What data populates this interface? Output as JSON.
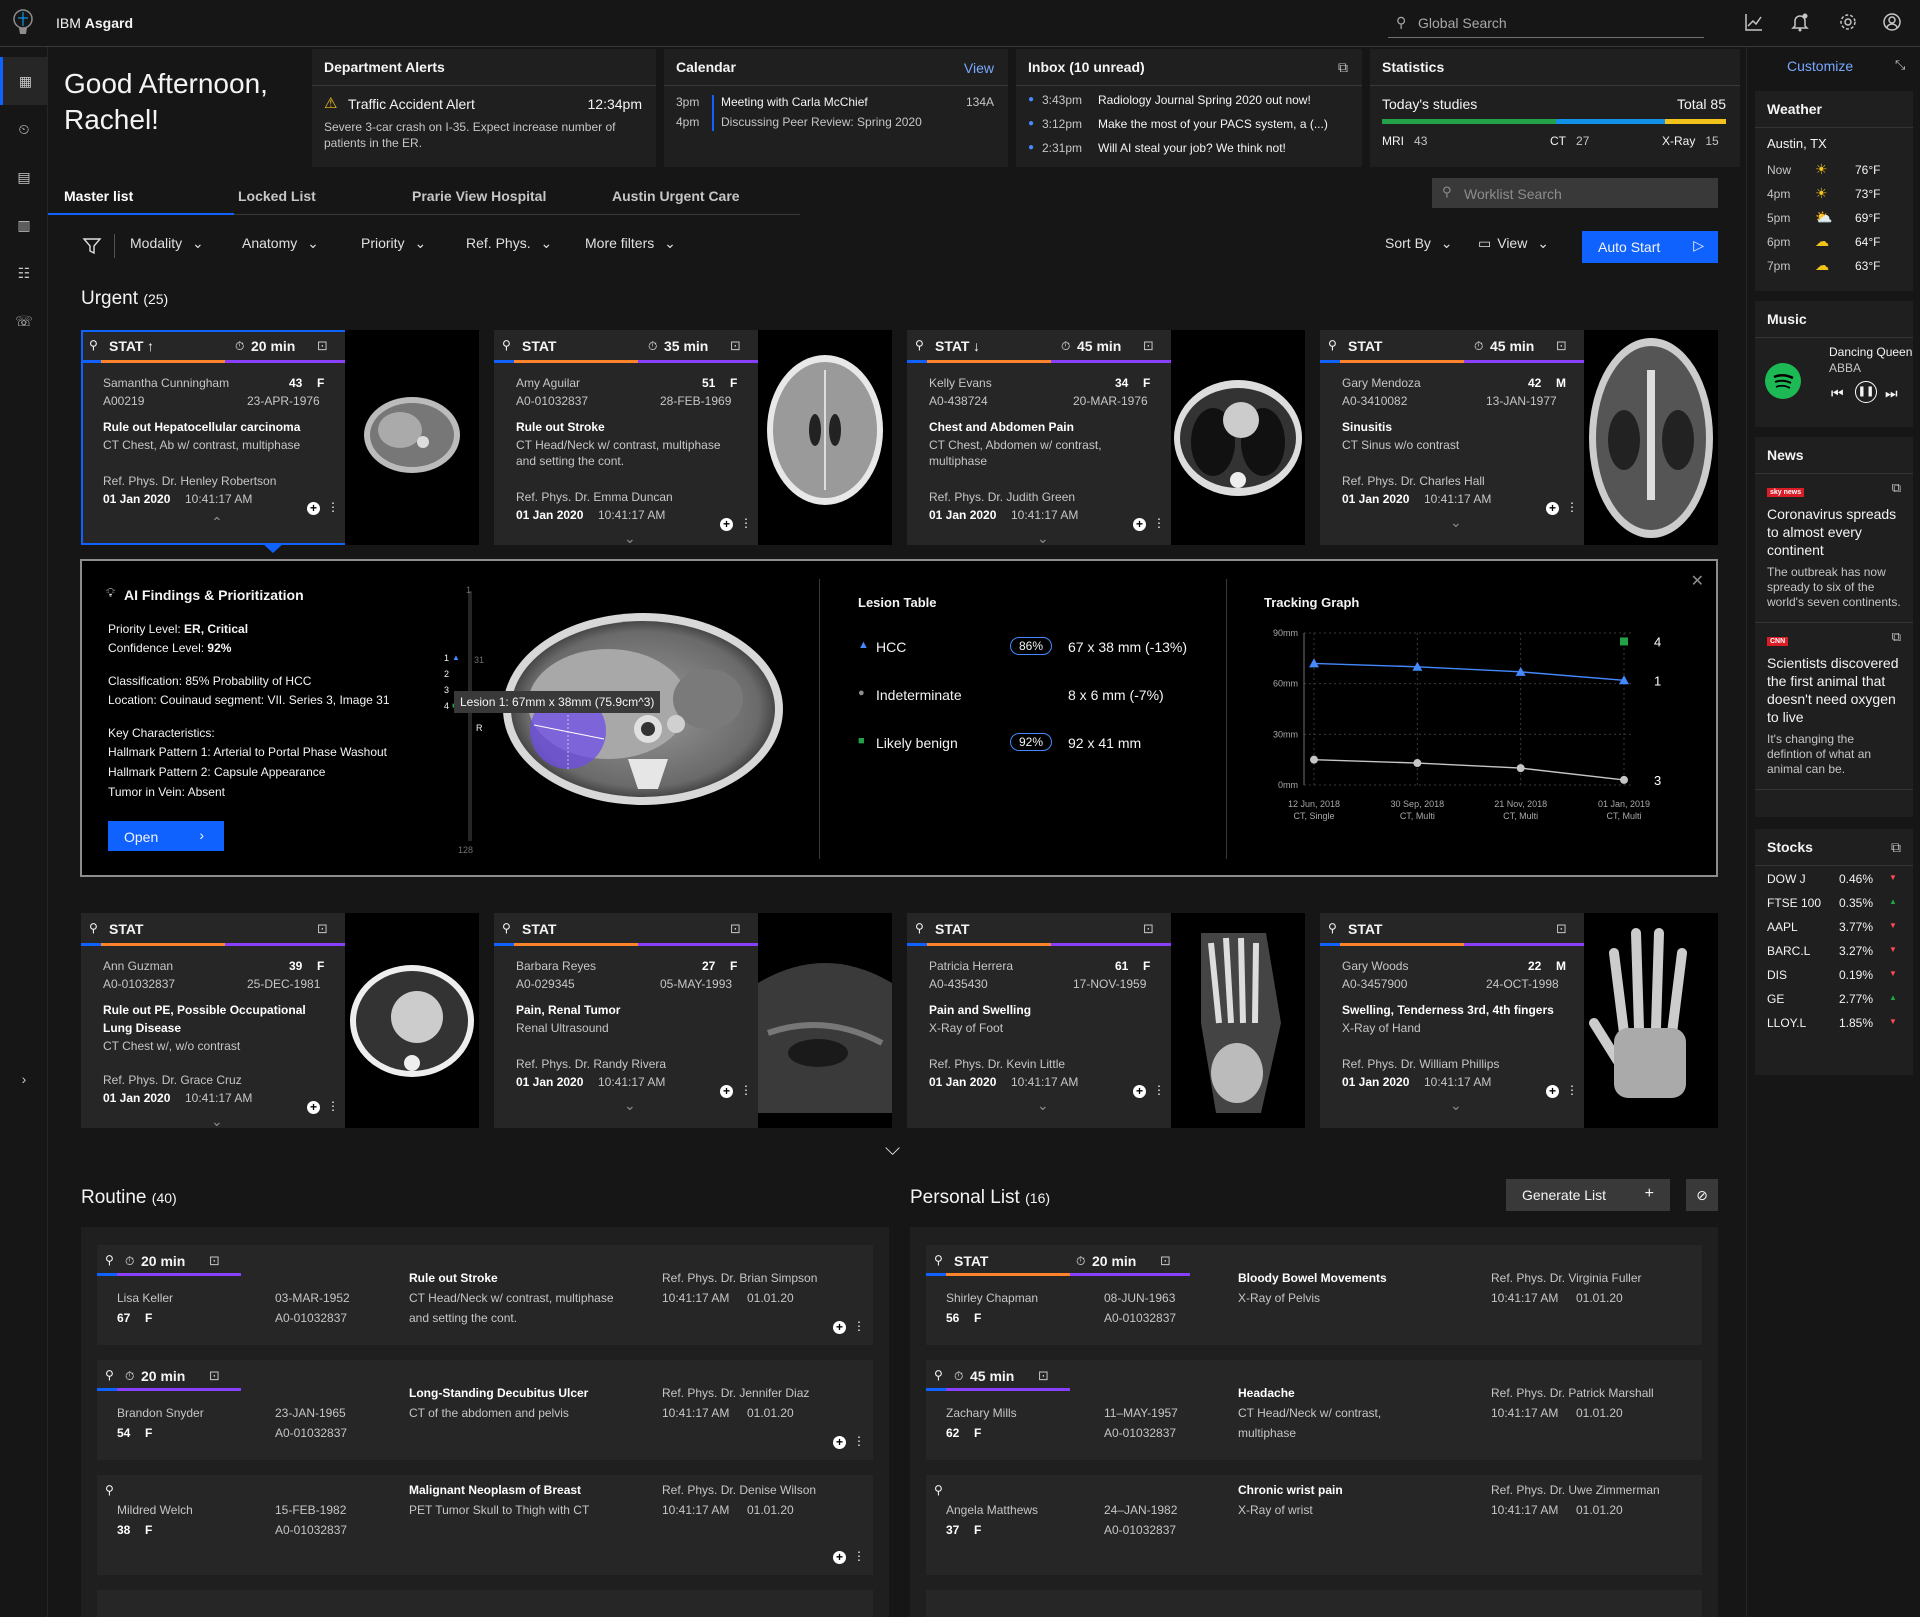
{
  "app": {
    "brand": "IBM",
    "name": "Asgard",
    "search_placeholder": "Global Search"
  },
  "greeting": {
    "line1": "Good Afternoon,",
    "line2": "Rachel!"
  },
  "alerts": {
    "title": "Department Alerts",
    "item_title": "Traffic Accident Alert",
    "time": "12:34pm",
    "body_line1": "Severe 3-car crash on I-35. Expect increase number of",
    "body_line2": "patients in the ER."
  },
  "calendar": {
    "title": "Calendar",
    "view": "View",
    "items": [
      {
        "time": "3pm",
        "text": "Meeting with Carla McChief",
        "room": "134A"
      },
      {
        "time": "4pm",
        "text": "Discussing Peer Review: Spring 2020",
        "room": ""
      }
    ]
  },
  "inbox": {
    "title": "Inbox (10 unread)",
    "items": [
      {
        "time": "3:43pm",
        "text": "Radiology Journal Spring 2020 out now!"
      },
      {
        "time": "3:12pm",
        "text": "Make the most of your PACS system, a (...)"
      },
      {
        "time": "2:31pm",
        "text": "Will AI steal your job? We think not!"
      }
    ]
  },
  "statistics": {
    "title": "Statistics",
    "label": "Today's studies",
    "total": "Total 85",
    "mri_label": "MRI",
    "mri": "43",
    "ct_label": "CT",
    "ct": "27",
    "xray_label": "X-Ray",
    "xray": "15",
    "bar_colors": [
      "#24a148",
      "#1192e8",
      "#f1c21b"
    ]
  },
  "tabs": [
    "Master list",
    "Locked List",
    "Prarie View Hospital",
    "Austin Urgent Care"
  ],
  "worklist_search": "Worklist Search",
  "filters": [
    "Modality",
    "Anatomy",
    "Priority",
    "Ref. Phys.",
    "More filters"
  ],
  "sort_by": "Sort By",
  "view": "View",
  "auto_start": "Auto Start",
  "urgent": {
    "title": "Urgent",
    "count": "(25)"
  },
  "urgent_cards": [
    {
      "stat": "STAT",
      "arrow": "↑",
      "timer": "20 min",
      "name": "Samantha Cunningham",
      "age": "43",
      "sex": "F",
      "id": "A00219",
      "dob": "23-APR-1976",
      "reason": "Rule out Hepatocellular carcinoma",
      "study1": "CT Chest, Ab w/ contrast, multiphase",
      "study2": "",
      "ref": "Ref. Phys. Dr. Henley Robertson",
      "date": "01 Jan 2020",
      "time": "10:41:17 AM"
    },
    {
      "stat": "STAT",
      "arrow": "",
      "timer": "35 min",
      "name": "Amy Aguilar",
      "age": "51",
      "sex": "F",
      "id": "A0-01032837",
      "dob": "28-FEB-1969",
      "reason": "Rule out Stroke",
      "study1": "CT Head/Neck w/ contrast, multiphase",
      "study2": "and setting the cont.",
      "ref": "Ref. Phys. Dr. Emma Duncan",
      "date": "01 Jan 2020",
      "time": "10:41:17 AM"
    },
    {
      "stat": "STAT",
      "arrow": "↓",
      "timer": "45 min",
      "name": "Kelly Evans",
      "age": "34",
      "sex": "F",
      "id": "A0-438724",
      "dob": "20-MAR-1976",
      "reason": "Chest and Abdomen Pain",
      "study1": "CT Chest, Abdomen w/ contrast,",
      "study2": "multiphase",
      "ref": "Ref. Phys. Dr. Judith Green",
      "date": "01 Jan 2020",
      "time": "10:41:17 AM"
    },
    {
      "stat": "STAT",
      "arrow": "",
      "timer": "45 min",
      "name": "Gary Mendoza",
      "age": "42",
      "sex": "M",
      "id": "A0-3410082",
      "dob": "13-JAN-1977",
      "reason": "Sinusitis",
      "study1": "CT Sinus w/o contrast",
      "study2": "",
      "ref": "Ref. Phys. Dr. Charles Hall",
      "date": "01 Jan 2020",
      "time": "10:41:17 AM"
    }
  ],
  "ai": {
    "title": "AI Findings & Prioritization",
    "priority_label": "Priority Level:",
    "priority": "ER, Critical",
    "confidence_label": "Confidence Level:",
    "confidence": "92%",
    "classification": "Classification: 85% Probability of HCC",
    "location": "Location: Couinaud segment: VII. Series 3, Image 31",
    "key": "Key Characteristics:",
    "k1": "Hallmark  Pattern 1: Arterial to Portal Phase Washout",
    "k2": "Hallmark Pattern 2: Capsule Appearance",
    "k3": "Tumor in Vein: Absent",
    "open": "Open",
    "lesion_tooltip": "Lesion 1: 67mm x 38mm (75.9cm^3)",
    "scroll_top": "1",
    "scroll_bottom": "128",
    "marker_31": "31",
    "r_label": "R",
    "markers": [
      "1",
      "2",
      "3",
      "4"
    ],
    "lesion_table_title": "Lesion Table",
    "lesions": [
      {
        "shape": "▲",
        "color": "#4589ff",
        "name": "HCC",
        "pct": "86%",
        "size": "67 x 38 mm (-13%)"
      },
      {
        "shape": "●",
        "color": "#8d8d8d",
        "name": "Indeterminate",
        "pct": "",
        "size": "8 x 6 mm (-7%)"
      },
      {
        "shape": "■",
        "color": "#24a148",
        "name": "Likely benign",
        "pct": "92%",
        "size": "92 x 41 mm"
      }
    ],
    "tracking_title": "Tracking Graph"
  },
  "chart_data": {
    "type": "line",
    "title": "Tracking Graph",
    "yticks": [
      "90mm",
      "60mm",
      "30mm",
      "0mm"
    ],
    "ylim": [
      0,
      90
    ],
    "categories": [
      "12 Jun, 2018",
      "30 Sep, 2018",
      "21 Nov, 2018",
      "01 Jan, 2019"
    ],
    "category_sub": [
      "CT, Single",
      "CT, Multi",
      "CT, Multi",
      "CT, Multi"
    ],
    "series": [
      {
        "label": "1",
        "color": "#4589ff",
        "marker": "triangle",
        "values": [
          72,
          70,
          67,
          62
        ]
      },
      {
        "label": "3",
        "color": "#c6c6c6",
        "marker": "circle",
        "values": [
          15,
          13,
          10,
          3
        ]
      }
    ],
    "extra_point": {
      "label": "4",
      "color": "#24a148",
      "value": 85
    }
  },
  "urgent_cards2": [
    {
      "stat": "STAT",
      "name": "Ann Guzman",
      "age": "39",
      "sex": "F",
      "id": "A0-01032837",
      "dob": "25-DEC-1981",
      "reason": "Rule out PE, Possible Occupational",
      "reason2": "Lung Disease",
      "study1": "CT Chest w/, w/o contrast",
      "ref": "Ref. Phys. Dr. Grace Cruz",
      "date": "01 Jan 2020",
      "time": "10:41:17 AM"
    },
    {
      "stat": "STAT",
      "name": "Barbara Reyes",
      "age": "27",
      "sex": "F",
      "id": "A0-029345",
      "dob": "05-MAY-1993",
      "reason": "Pain, Renal Tumor",
      "reason2": "",
      "study1": "Renal Ultrasound",
      "ref": "Ref. Phys. Dr. Randy Rivera",
      "date": "01 Jan 2020",
      "time": "10:41:17 AM"
    },
    {
      "stat": "STAT",
      "name": "Patricia Herrera",
      "age": "61",
      "sex": "F",
      "id": "A0-435430",
      "dob": "17-NOV-1959",
      "reason": "Pain and Swelling",
      "reason2": "",
      "study1": "X-Ray of Foot",
      "ref": "Ref. Phys. Dr. Kevin Little",
      "date": "01 Jan 2020",
      "time": "10:41:17 AM"
    },
    {
      "stat": "STAT",
      "name": "Gary Woods",
      "age": "22",
      "sex": "M",
      "id": "A0-3457900",
      "dob": "24-OCT-1998",
      "reason": "Swelling, Tenderness 3rd, 4th fingers",
      "reason2": "",
      "study1": "X-Ray of Hand",
      "ref": "Ref. Phys. Dr. William Phillips",
      "date": "01 Jan 2020",
      "time": "10:41:17 AM"
    }
  ],
  "routine": {
    "title": "Routine",
    "count": "(40)"
  },
  "routine_rows": [
    {
      "timer": "20 min",
      "name": "Lisa Keller",
      "age": "67",
      "sex": "F",
      "dob": "03-MAR-1952",
      "id": "A0-01032837",
      "reason": "Rule out Stroke",
      "study": "CT Head/Neck w/ contrast, multiphase",
      "study2": "and setting the cont.",
      "ref": "Ref. Phys. Dr. Brian Simpson",
      "time": "10:41:17 AM",
      "date": "01.01.20"
    },
    {
      "timer": "20 min",
      "name": "Brandon Snyder",
      "age": "54",
      "sex": "F",
      "dob": "23-JAN-1965",
      "id": "A0-01032837",
      "reason": "Long-Standing Decubitus Ulcer",
      "study": "CT of the abdomen and pelvis",
      "study2": "",
      "ref": "Ref. Phys. Dr. Jennifer Diaz",
      "time": "10:41:17 AM",
      "date": "01.01.20"
    },
    {
      "timer": "",
      "name": "Mildred Welch",
      "age": "38",
      "sex": "F",
      "dob": "15-FEB-1982",
      "id": "A0-01032837",
      "reason": "Malignant Neoplasm of Breast",
      "study": "PET Tumor Skull to Thigh with CT",
      "study2": "",
      "ref": "Ref. Phys. Dr. Denise Wilson",
      "time": "10:41:17 AM",
      "date": "01.01.20"
    }
  ],
  "personal": {
    "title": "Personal List",
    "count": "(16)",
    "generate": "Generate List"
  },
  "personal_rows": [
    {
      "stat": "STAT",
      "timer": "20 min",
      "name": "Shirley Chapman",
      "age": "56",
      "sex": "F",
      "dob": "08-JUN-1963",
      "id": "A0-01032837",
      "reason": "Bloody Bowel Movements",
      "study": "X-Ray of Pelvis",
      "study2": "",
      "ref": "Ref. Phys. Dr. Virginia Fuller",
      "time": "10:41:17 AM",
      "date": "01.01.20"
    },
    {
      "stat": "",
      "timer": "45 min",
      "name": "Zachary Mills",
      "age": "62",
      "sex": "F",
      "dob": "11–MAY-1957",
      "id": "A0-01032837",
      "reason": "Headache",
      "study": "CT Head/Neck w/ contrast,",
      "study2": "multiphase",
      "ref": "Ref. Phys. Dr. Patrick Marshall",
      "time": "10:41:17 AM",
      "date": "01.01.20"
    },
    {
      "stat": "",
      "timer": "",
      "name": "Angela Matthews",
      "age": "37",
      "sex": "F",
      "dob": "24–JAN-1982",
      "id": "A0-01032837",
      "reason": "Chronic wrist pain",
      "study": "X-Ray of wrist",
      "study2": "",
      "ref": "Ref. Phys. Dr. Uwe Zimmerman",
      "time": "10:41:17 AM",
      "date": "01.01.20"
    }
  ],
  "right": {
    "customize": "Customize",
    "weather": {
      "title": "Weather",
      "city": "Austin, TX",
      "rows": [
        {
          "t": "Now",
          "icon": "☀",
          "v": "76°F"
        },
        {
          "t": "4pm",
          "icon": "☀",
          "v": "73°F"
        },
        {
          "t": "5pm",
          "icon": "⛅",
          "v": "69°F"
        },
        {
          "t": "6pm",
          "icon": "☁",
          "v": "64°F"
        },
        {
          "t": "7pm",
          "icon": "☁",
          "v": "63°F"
        }
      ]
    },
    "music": {
      "title": "Music",
      "song": "Dancing Queen",
      "artist": "ABBA"
    },
    "news": {
      "title": "News",
      "items": [
        {
          "src": "sky news",
          "head": "Coronavirus spreads to almost every continent",
          "body": "The outbreak has now spready to six of the world's seven continents."
        },
        {
          "src": "CNN",
          "head": "Scientists discovered the first animal that doesn't need oxygen to live",
          "body": "It's changing the defintion of what an animal can be."
        }
      ]
    },
    "stocks": {
      "title": "Stocks",
      "items": [
        {
          "n": "DOW J",
          "v": "0.46%",
          "dir": "▼",
          "c": "#fa4d56"
        },
        {
          "n": "FTSE 100",
          "v": "0.35%",
          "dir": "▲",
          "c": "#24a148"
        },
        {
          "n": "AAPL",
          "v": "3.77%",
          "dir": "▼",
          "c": "#fa4d56"
        },
        {
          "n": "BARC.L",
          "v": "3.27%",
          "dir": "▼",
          "c": "#fa4d56"
        },
        {
          "n": "DIS",
          "v": "0.19%",
          "dir": "▼",
          "c": "#fa4d56"
        },
        {
          "n": "GE",
          "v": "2.77%",
          "dir": "▲",
          "c": "#24a148"
        },
        {
          "n": "LLOY.L",
          "v": "1.85%",
          "dir": "▼",
          "c": "#fa4d56"
        }
      ]
    }
  }
}
